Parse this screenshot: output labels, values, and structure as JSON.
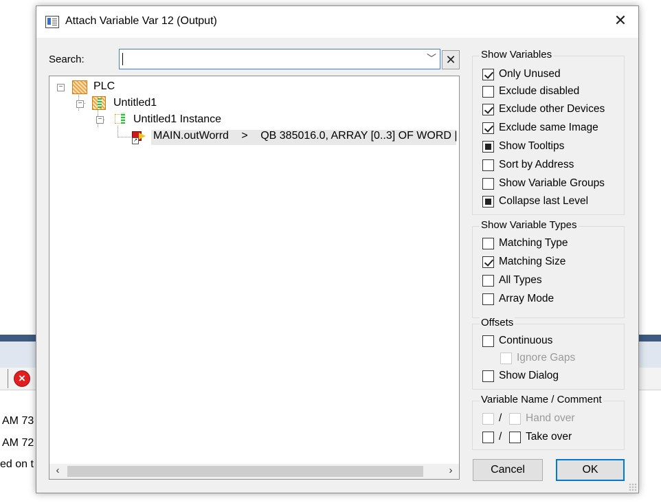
{
  "background": {
    "log_lines": [
      "AM 73",
      "AM 72",
      "ed on t"
    ]
  },
  "dialog": {
    "title": "Attach Variable Var 12 (Output)",
    "search": {
      "label": "Search:",
      "value": ""
    },
    "tree": {
      "nodes": [
        {
          "label": "PLC"
        },
        {
          "label": "Untitled1"
        },
        {
          "label": "Untitled1 Instance"
        },
        {
          "label": "MAIN.outWorrd",
          "arrow": ">",
          "detail": "QB 385016.0, ARRAY [0..3] OF WORD |"
        }
      ]
    },
    "groups": {
      "show_variables": {
        "title": "Show Variables",
        "items": [
          {
            "label": "Only Unused",
            "state": "checked"
          },
          {
            "label": "Exclude disabled",
            "state": "unchecked"
          },
          {
            "label": "Exclude other Devices",
            "state": "checked"
          },
          {
            "label": "Exclude same Image",
            "state": "checked"
          },
          {
            "label": "Show Tooltips",
            "state": "indeterminate"
          },
          {
            "label": "Sort by Address",
            "state": "unchecked"
          },
          {
            "label": "Show Variable Groups",
            "state": "unchecked"
          },
          {
            "label": "Collapse last Level",
            "state": "indeterminate"
          }
        ]
      },
      "show_variable_types": {
        "title": "Show Variable Types",
        "items": [
          {
            "label": "Matching Type",
            "state": "unchecked"
          },
          {
            "label": "Matching Size",
            "state": "checked"
          },
          {
            "label": "All Types",
            "state": "unchecked"
          },
          {
            "label": "Array Mode",
            "state": "unchecked"
          }
        ]
      },
      "offsets": {
        "title": "Offsets",
        "items": [
          {
            "label": "Continuous",
            "state": "unchecked"
          },
          {
            "label": "Ignore Gaps",
            "state": "disabled"
          },
          {
            "label": "Show Dialog",
            "state": "unchecked"
          }
        ]
      },
      "variable_name_comment": {
        "title": "Variable Name / Comment",
        "separator": "/",
        "items": [
          {
            "label": "Hand over",
            "state": "disabled"
          },
          {
            "label": "Take over",
            "state": "unchecked"
          }
        ]
      }
    },
    "buttons": {
      "cancel": "Cancel",
      "ok": "OK"
    }
  }
}
